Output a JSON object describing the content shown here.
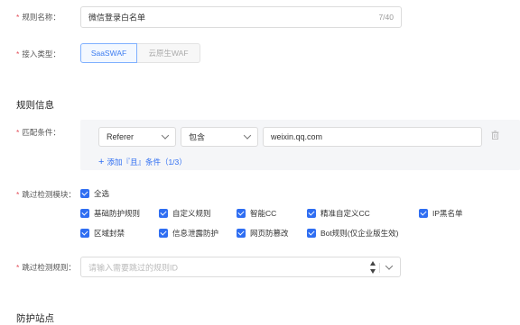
{
  "form": {
    "rule_name": {
      "label": "规则名称：",
      "value": "微信登录白名单",
      "count": "7/40"
    },
    "access_type": {
      "label": "接入类型：",
      "options": [
        "SaaSWAF",
        "云原生WAF"
      ],
      "selected": "SaaSWAF"
    },
    "section_rule_info": "规则信息",
    "match": {
      "label": "匹配条件：",
      "field": "Referer",
      "operator": "包含",
      "value": "weixin.qq.com",
      "add_label": "添加『且』条件（1/3）"
    },
    "skip_modules": {
      "label": "跳过检测模块：",
      "select_all": "全选",
      "items": [
        "基础防护规则",
        "自定义规则",
        "智能CC",
        "精准自定义CC",
        "IP黑名单",
        "区域封禁",
        "信息泄露防护",
        "网页防篡改",
        "Bot规则(仅企业版生效)"
      ],
      "all_checked": true
    },
    "skip_rules": {
      "label": "跳过检测规则：",
      "placeholder": "请输入需要跳过的规则ID"
    },
    "section_sites": "防护站点"
  },
  "colors": {
    "accent": "#2f6ef2",
    "required": "#e34d59",
    "panel_bg": "#f5f6f8"
  }
}
